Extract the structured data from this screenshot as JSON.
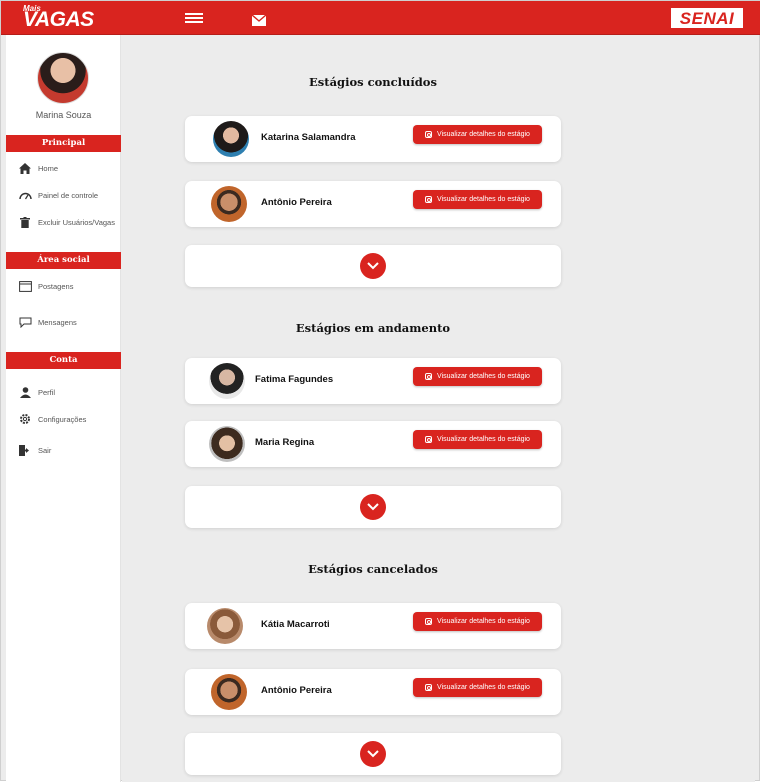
{
  "header": {
    "logo_small": "Mais",
    "logo_big": "VAGAS",
    "menu_icon": "hamburger-icon",
    "mail_icon": "envelope-icon",
    "brand": "SENAI"
  },
  "sidebar": {
    "user_name": "Marina Souza",
    "sections": [
      {
        "title": "Principal",
        "items": [
          {
            "label": "Home",
            "icon": "home-icon"
          },
          {
            "label": "Painel de controle",
            "icon": "dashboard-icon"
          },
          {
            "label": "Excluir Usuários/Vagas",
            "icon": "trash-icon"
          }
        ]
      },
      {
        "title": "Área social",
        "items": [
          {
            "label": "Postagens",
            "icon": "posts-icon"
          },
          {
            "label": "Mensagens",
            "icon": "chat-icon"
          }
        ]
      },
      {
        "title": "Conta",
        "items": [
          {
            "label": "Perfil",
            "icon": "user-icon"
          },
          {
            "label": "Configurações",
            "icon": "gear-icon"
          },
          {
            "label": "Sair",
            "icon": "logout-icon"
          }
        ]
      }
    ]
  },
  "main": {
    "button_label": "Visualizar detalhes do estágio",
    "groups": [
      {
        "title": "Estágios concluídos",
        "people": [
          "Katarina Salamandra",
          "Antônio Pereira"
        ]
      },
      {
        "title": "Estágios em andamento",
        "people": [
          "Fatima  Fagundes",
          "Maria Regina"
        ]
      },
      {
        "title": "Estágios cancelados",
        "people": [
          "Kátia Macarroti",
          "Antônio Pereira"
        ]
      }
    ]
  },
  "colors": {
    "accent": "#d9241f",
    "background": "#ececec",
    "card": "#ffffff"
  }
}
